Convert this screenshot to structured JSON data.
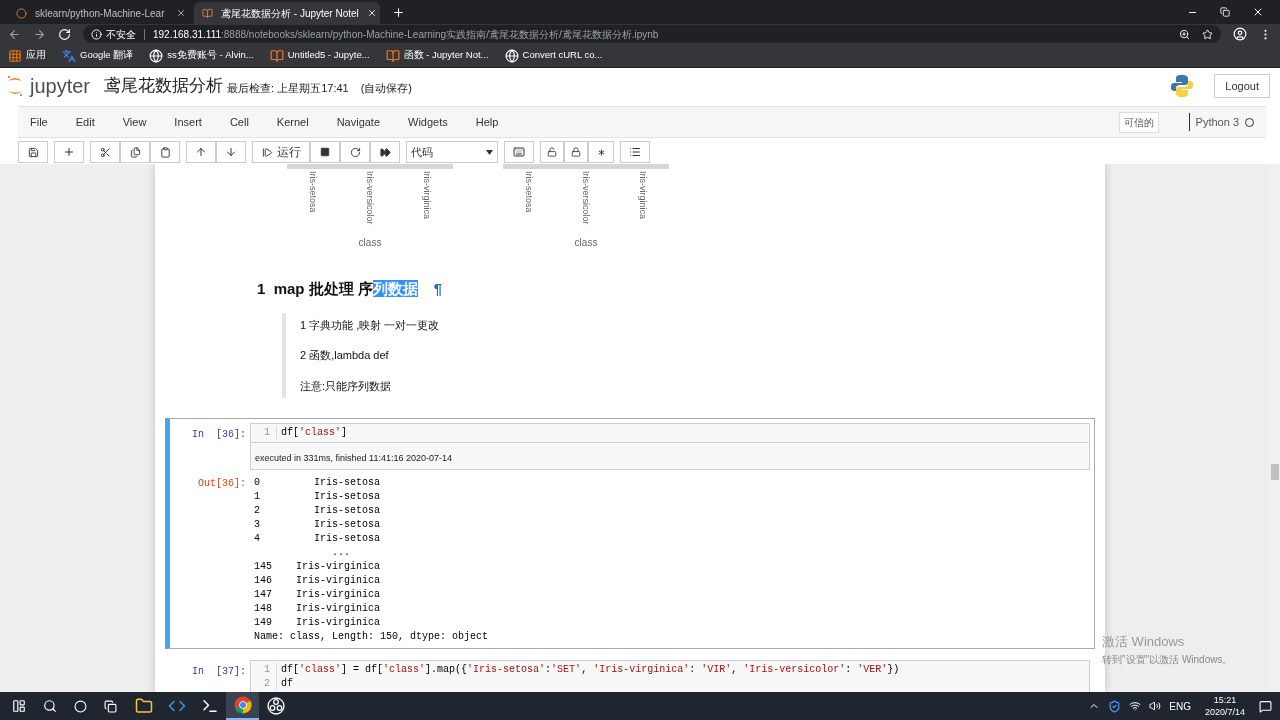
{
  "browser": {
    "tabs": [
      {
        "title": "sklearn/python-Machine-Lear",
        "selected": false
      },
      {
        "title": "鸢尾花数据分析 - Jupyter Notel",
        "selected": true
      }
    ],
    "security": "不安全",
    "url_host": "192.168.31.111",
    "url_path": ":8888/notebooks/sklearn/python-Machine-Learning实践指南/鸢尾花数据分析/鸢尾花数据分析.ipynb",
    "bookmarks": [
      {
        "label": "应用",
        "kind": "apps"
      },
      {
        "label": "Google 翻译",
        "kind": "translate"
      },
      {
        "label": "ss免费账号 - Alvin...",
        "kind": "globe"
      },
      {
        "label": "Untitled5 - Jupyte...",
        "kind": "jupyter"
      },
      {
        "label": "函数 - Jupyter Not...",
        "kind": "jupyter"
      },
      {
        "label": "Convert cURL co...",
        "kind": "globe"
      }
    ]
  },
  "header": {
    "logo": "jupyter",
    "notebook_name": "鸢尾花数据分析",
    "checkpoint": "最后检查: 上星期五17:41",
    "autosave": "(自动保存)",
    "logout": "Logout"
  },
  "menu": [
    "File",
    "Edit",
    "View",
    "Insert",
    "Cell",
    "Kernel",
    "Navigate",
    "Widgets",
    "Help"
  ],
  "trusted": "可信的",
  "kernel": "Python 3",
  "kernel_busy": false,
  "toolbar": {
    "run_label": "运行",
    "cell_type": "代码"
  },
  "chart_residue": [
    {
      "ticks": [
        "Iris-setosa",
        "Iris-versicolor",
        "Iris-virginica"
      ],
      "xlabel": "class"
    },
    {
      "ticks": [
        "Iris-setosa",
        "Iris-versicolor",
        "Iris-virginica"
      ],
      "xlabel": "class"
    }
  ],
  "heading": {
    "parts": [
      {
        "text": "1  map 批处理 序",
        "selected": false
      },
      {
        "text": "列数据",
        "selected": true
      }
    ],
    "anchor": "¶"
  },
  "quote": [
    "1 字典功能 ,映射 一对一更改",
    "2 函数,lambda def",
    "注意:只能序列数据"
  ],
  "cells": [
    {
      "prompt": "In  [36]:",
      "selected": true,
      "code": [
        {
          "num": "1",
          "text": "df['class']"
        }
      ],
      "exec_info": "executed in 331ms, finished 11:41:16 2020-07-14",
      "out_prompt": "Out[36]:",
      "output": [
        "0         Iris-setosa",
        "1         Iris-setosa",
        "2         Iris-setosa",
        "3         Iris-setosa",
        "4         Iris-setosa",
        "             ...",
        "145    Iris-virginica",
        "146    Iris-virginica",
        "147    Iris-virginica",
        "148    Iris-virginica",
        "149    Iris-virginica",
        "Name: class, Length: 150, dtype: object"
      ]
    },
    {
      "prompt": "In  [37]:",
      "selected": false,
      "code": [
        {
          "num": "1",
          "text": "df['class'] = df['class'].map({'Iris-setosa':'SET', 'Iris-virginica': 'VIR', 'Iris-versicolor': 'VER'})"
        },
        {
          "num": "2",
          "text": "df"
        }
      ]
    }
  ],
  "activation": {
    "title": "激活 Windows",
    "hint": "转到\"设置\"以激活 Windows。"
  },
  "taskbar": {
    "apps": [
      {
        "kind": "explorer",
        "active": false
      },
      {
        "kind": "vscode",
        "active": false
      },
      {
        "kind": "terminal",
        "active": false
      },
      {
        "kind": "chrome",
        "active": true
      },
      {
        "kind": "obs",
        "active": false
      }
    ],
    "lang": "ENG",
    "time": "15:21",
    "date": "2020/7/14"
  }
}
